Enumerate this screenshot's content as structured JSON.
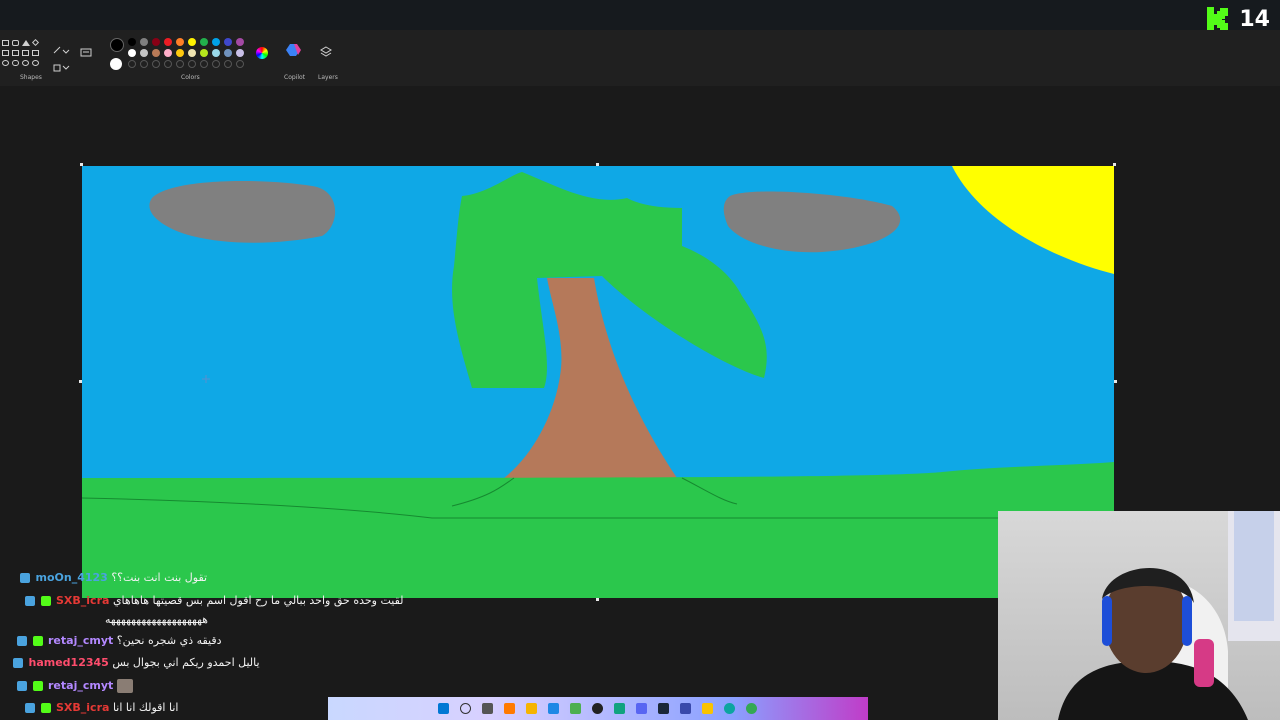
{
  "app": {
    "ribbon": {
      "shapes_label": "Shapes",
      "colors_label": "Colors",
      "copilot_label": "Copilot",
      "layers_label": "Layers"
    },
    "palette": [
      "#000000",
      "#7f7f7f",
      "#880015",
      "#ed1c24",
      "#ff7f27",
      "#fff200",
      "#22b14c",
      "#00a2e8",
      "#3f48cc",
      "#a349a4",
      "#ffffff",
      "#c3c3c3",
      "#b97a57",
      "#ffaec9",
      "#ffc90e",
      "#efe4b0",
      "#b5e61d",
      "#99d9ea",
      "#7092be",
      "#c8bfe7"
    ],
    "primary_color": "#000000",
    "secondary_color": "#ffffff"
  },
  "drawing": {
    "sky": "#0fa8e6",
    "sun": "#ffff00",
    "clouds": "#808080",
    "leaves": "#2bc74c",
    "trunk": "#b5795a",
    "grass": "#2bc74c"
  },
  "stream": {
    "viewer_count": "14",
    "brand_color": "#53fc18"
  },
  "chat": [
    {
      "user": "moOn_4123",
      "color": "#4aa3df",
      "text": "تقول بنت انت بنت؟؟"
    },
    {
      "user": "SXB_icra",
      "color": "#e53935",
      "text": "لقيت وحده حق واحد ببالي ما رح اقول اسم بس قصيتها هاهاهاي",
      "text2": "هههههههههههههههههههه"
    },
    {
      "user": "retaj_cmyt",
      "color": "#b388ff",
      "text": "دقيقه ذي شجره نحين؟"
    },
    {
      "user": "hamed12345",
      "color": "#ff4d6d",
      "text": "ياليل احمدو ريكم اني بجوال بس"
    },
    {
      "user": "retaj_cmyt",
      "color": "#b388ff",
      "text": ""
    },
    {
      "user": "SXB_icra",
      "color": "#e53935",
      "text": "انا اقولك انا انا"
    }
  ]
}
